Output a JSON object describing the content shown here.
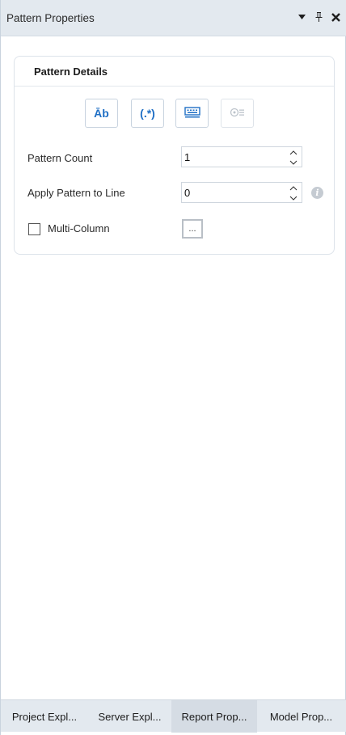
{
  "header": {
    "title": "Pattern Properties"
  },
  "card": {
    "title": "Pattern Details",
    "tools": [
      {
        "icon": "text-icon",
        "glyph": "Āb"
      },
      {
        "icon": "regex-icon",
        "glyph": "(.*)"
      },
      {
        "icon": "keyboard-icon"
      },
      {
        "icon": "pattern-list-icon"
      }
    ]
  },
  "fields": {
    "pattern_count": {
      "label": "Pattern Count",
      "value": "1"
    },
    "apply_to_line": {
      "label": "Apply Pattern to Line",
      "value": "0"
    },
    "multi_column": {
      "label": "Multi-Column",
      "checked": false,
      "button_label": "..."
    }
  },
  "tabs": [
    {
      "label": "Project Expl...",
      "active": false
    },
    {
      "label": "Server Expl...",
      "active": false
    },
    {
      "label": "Report Prop...",
      "active": true
    },
    {
      "label": "Model Prop...",
      "active": false
    }
  ],
  "colors": {
    "accent": "#1f6fc5",
    "titlebar": "#e3e9ef"
  }
}
